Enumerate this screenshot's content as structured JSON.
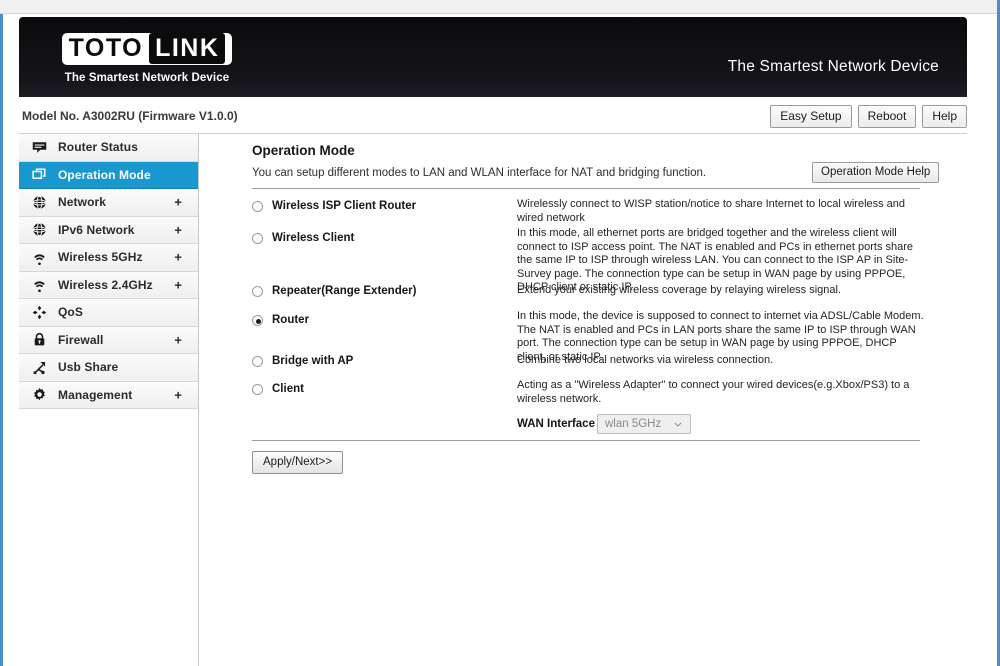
{
  "brand": {
    "logo_toto": "TOTO",
    "logo_link": "LINK",
    "logo_tagline": "The Smartest Network Device",
    "header_tagline": "The Smartest Network Device"
  },
  "modelbar": {
    "model_text": "Model No. A3002RU (Firmware V1.0.0)",
    "buttons": [
      {
        "label": "Easy Setup",
        "name": "easy-setup-button"
      },
      {
        "label": "Reboot",
        "name": "reboot-button"
      },
      {
        "label": "Help",
        "name": "help-button"
      }
    ]
  },
  "sidebar": {
    "items": [
      {
        "label": "Router Status",
        "icon": "speech-bubble-icon",
        "expandable": false,
        "active": false
      },
      {
        "label": "Operation Mode",
        "icon": "windows-stack-icon",
        "expandable": false,
        "active": true
      },
      {
        "label": "Network",
        "icon": "globe-icon",
        "expandable": true,
        "active": false
      },
      {
        "label": "IPv6 Network",
        "icon": "globe-icon",
        "expandable": true,
        "active": false
      },
      {
        "label": "Wireless 5GHz",
        "icon": "wifi-icon",
        "expandable": true,
        "active": false
      },
      {
        "label": "Wireless 2.4GHz",
        "icon": "wifi-icon",
        "expandable": true,
        "active": false
      },
      {
        "label": "QoS",
        "icon": "four-arrows-icon",
        "expandable": false,
        "active": false
      },
      {
        "label": "Firewall",
        "icon": "padlock-icon",
        "expandable": true,
        "active": false
      },
      {
        "label": "Usb Share",
        "icon": "usb-icon",
        "expandable": false,
        "active": false
      },
      {
        "label": "Management",
        "icon": "gear-icon",
        "expandable": true,
        "active": false
      }
    ],
    "expand_symbol": "+"
  },
  "content": {
    "title": "Operation Mode",
    "subtitle": "You can setup different modes to LAN and WLAN interface for NAT and bridging function.",
    "help_button": "Operation Mode Help",
    "modes": [
      {
        "label": "Wireless ISP Client Router",
        "checked": false,
        "desc": "Wirelessly connect to WISP station/notice to share Internet to local wireless and wired network"
      },
      {
        "label": "Wireless Client",
        "checked": false,
        "desc": "In this mode, all ethernet ports are bridged together and the wireless client will connect to ISP access point. The NAT is enabled and PCs in ethernet ports share the same IP to ISP through wireless LAN. You can connect to the ISP AP in Site-Survey page. The connection type can be setup in WAN page by using PPPOE, DHCP client or static IP."
      },
      {
        "label": "Repeater(Range Extender)",
        "checked": false,
        "desc": "Extend your existing wireless coverage by relaying wireless signal."
      },
      {
        "label": "Router",
        "checked": true,
        "desc": "In this mode, the device is supposed to connect to internet via ADSL/Cable Modem. The NAT is enabled and PCs in LAN ports share the same IP to ISP through WAN port. The connection type can be setup in WAN page by using PPPOE, DHCP client, or static IP."
      },
      {
        "label": "Bridge with AP",
        "checked": false,
        "desc": "Combine two local networks via wireless connection."
      },
      {
        "label": "Client",
        "checked": false,
        "desc": "Acting as a \"Wireless Adapter\" to connect your wired devices(e.g.Xbox/PS3) to a wireless network."
      }
    ],
    "wan_interface_label": "WAN Interface",
    "wan_interface_value": "wlan 5GHz",
    "apply_button": "Apply/Next>>"
  },
  "colors": {
    "accent": "#1898cf",
    "header_bg": "#0d0d10",
    "frame_blue": "#4a90c4"
  }
}
